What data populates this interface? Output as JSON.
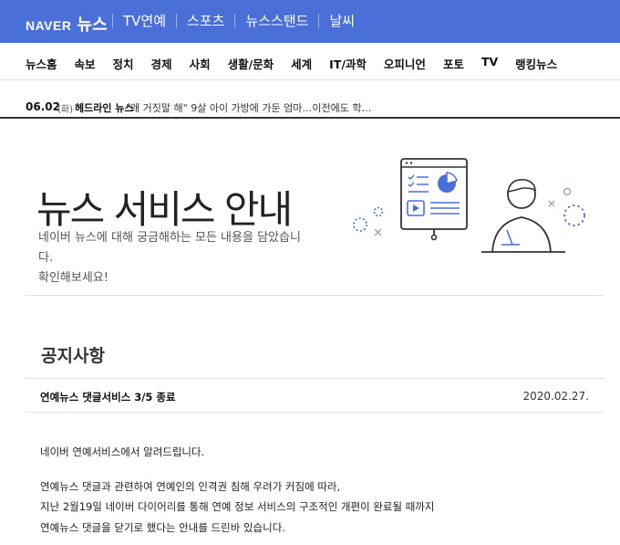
{
  "header": {
    "logo_naver": "NAVER",
    "logo_news": "뉴스",
    "topnav": [
      "TV연예",
      "스포츠",
      "뉴스스탠드",
      "날씨"
    ]
  },
  "category_nav": [
    "뉴스홈",
    "속보",
    "정치",
    "경제",
    "사회",
    "생활/문화",
    "세계",
    "IT/과학",
    "오피니언",
    "포토",
    "TV",
    "랭킹뉴스"
  ],
  "headline_bar": {
    "date": "06.02",
    "day": "(화)",
    "label": "헤드라인 뉴스",
    "text": "\"왜 거짓말 해\" 9살 아이 가방에 가둔 엄마…이전에도 학…"
  },
  "hero": {
    "title": "뉴스 서비스 안내",
    "desc_line1": "네이버 뉴스에 대해 궁금해하는 모든 내용을 담았습니다.",
    "desc_line2": "확인해보세요!",
    "illustration": "person-with-presentation-board-icon",
    "accent_color": "#4a6fd6"
  },
  "notice": {
    "heading": "공지사항",
    "item_title": "연예뉴스 댓글서비스 3/5 종료",
    "item_date": "2020.02.27.",
    "body": [
      "네이버 연예서비스에서 알려드립니다.",
      "연예뉴스 댓글과 관련하여 연예인의 인격권 침해 우려가 커짐에 따라,",
      "지난 2월19일 네이버 다이어리를 통해 연예 정보 서비스의 구조적인 개편이 완료될 때까지",
      "연예뉴스 댓글을 닫기로 했다는 안내를 드린바 있습니다."
    ]
  }
}
